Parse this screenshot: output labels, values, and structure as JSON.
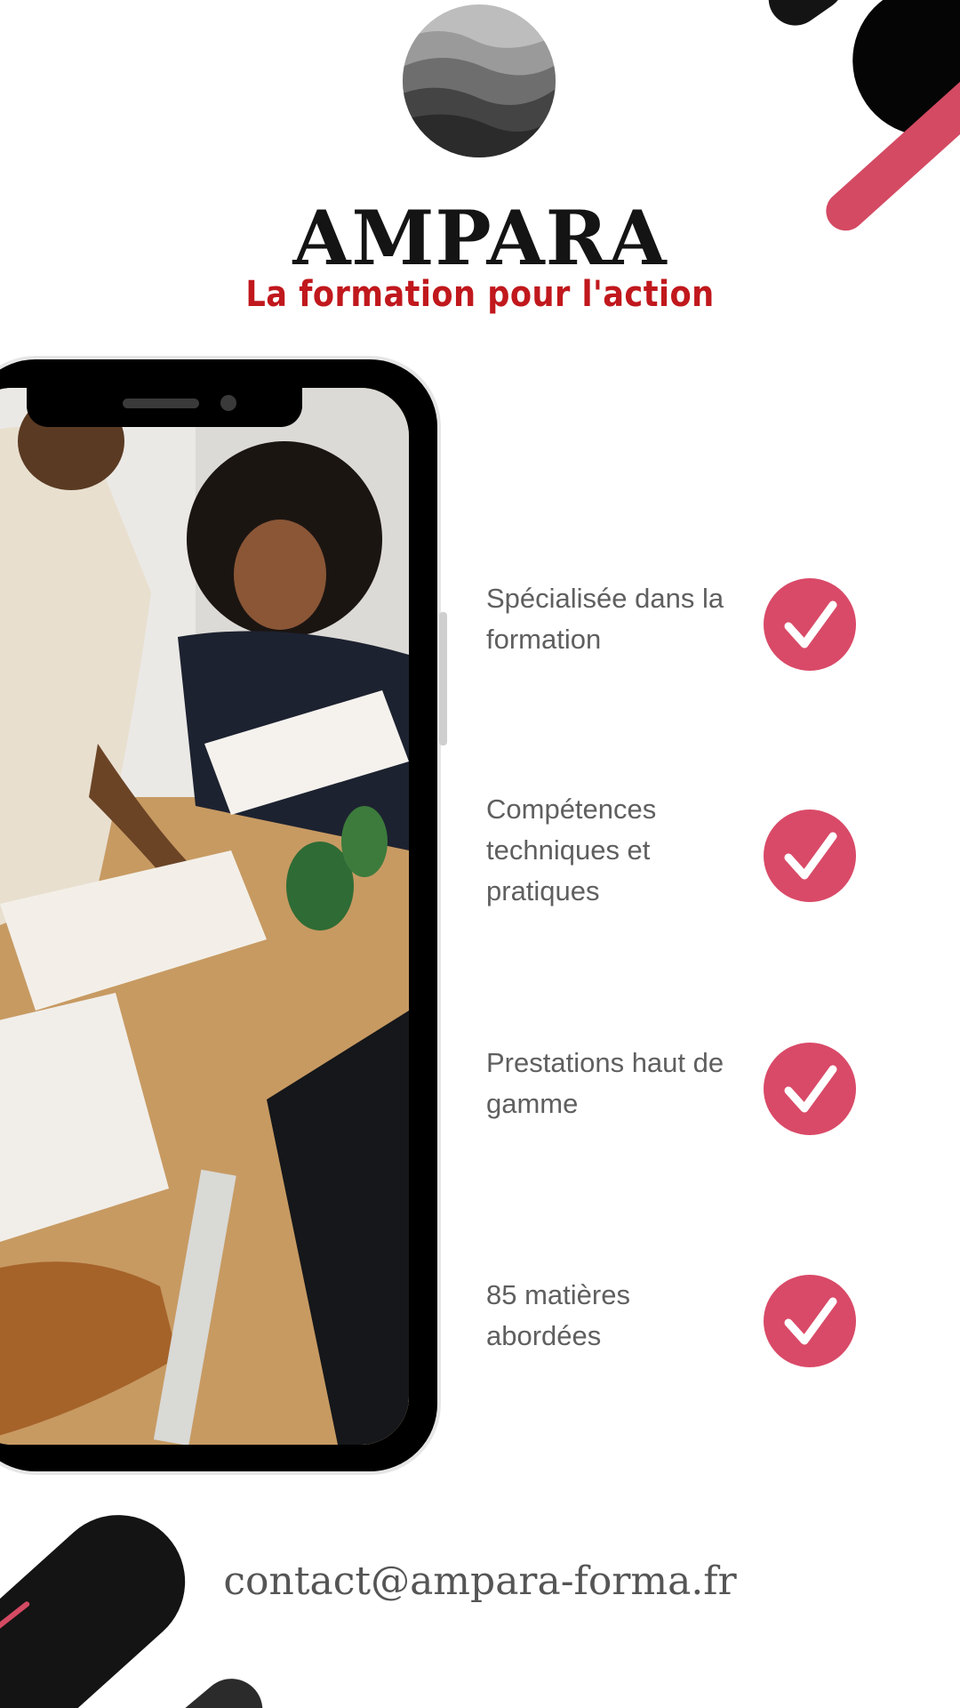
{
  "brand": {
    "name": "AMPARA",
    "tagline": "La formation pour l'action",
    "tagline_color": "#c0181d",
    "logo_icon": "mountain-wave-circle"
  },
  "colors": {
    "accent": "#d94a68",
    "text": "#5f5f5f",
    "dark": "#141414"
  },
  "phone": {
    "image_description_icon": "classroom-photo"
  },
  "features": [
    {
      "label": "Spécialisée dans la formation",
      "icon": "check-icon"
    },
    {
      "label": "Compétences techniques et pratiques",
      "icon": "check-icon"
    },
    {
      "label": "Prestations haut de gamme",
      "icon": "check-icon"
    },
    {
      "label": "85 matières abordées",
      "icon": "check-icon"
    }
  ],
  "contact": {
    "email": "contact@ampara-forma.fr"
  }
}
